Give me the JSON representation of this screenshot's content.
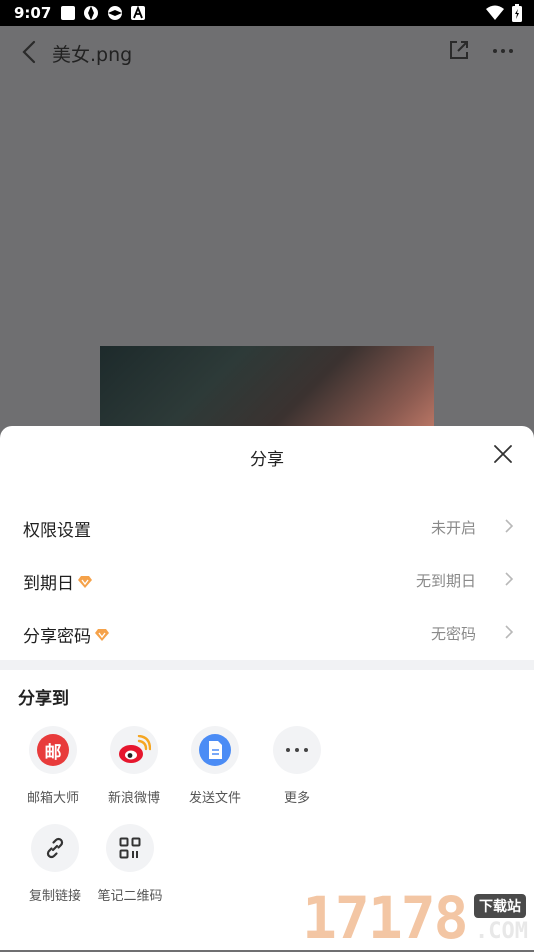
{
  "status": {
    "time": "9:07"
  },
  "viewer": {
    "title": "美女.png"
  },
  "sheet": {
    "title": "分享",
    "settings": [
      {
        "label": "权限设置",
        "value": "未开启",
        "vip": false
      },
      {
        "label": "到期日",
        "value": "无到期日",
        "vip": true
      },
      {
        "label": "分享密码",
        "value": "无密码",
        "vip": true
      }
    ],
    "share_to_title": "分享到",
    "share_items": [
      {
        "label": "邮箱大师",
        "icon": "mail-master-icon",
        "color": "#e83b3b"
      },
      {
        "label": "新浪微博",
        "icon": "weibo-icon",
        "color": "#e6162d"
      },
      {
        "label": "发送文件",
        "icon": "file-icon",
        "color": "#4b8cf5"
      },
      {
        "label": "更多",
        "icon": "more-dots-icon",
        "color": "#444444"
      },
      {
        "label": "复制链接",
        "icon": "link-icon",
        "color": "#333333"
      },
      {
        "label": "笔记二维码",
        "icon": "qrcode-icon",
        "color": "#333333"
      }
    ],
    "mail_glyph": "邮"
  },
  "watermark": {
    "digits": "17178",
    "badge": "下载站",
    "com": ".COM"
  }
}
